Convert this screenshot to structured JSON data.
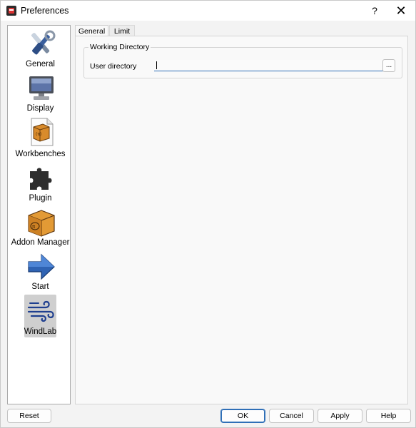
{
  "window": {
    "title": "Preferences",
    "help_label": "?",
    "close_label": "✕"
  },
  "sidebar": {
    "items": [
      {
        "label": "General",
        "icon": "tools-icon"
      },
      {
        "label": "Display",
        "icon": "monitor-icon"
      },
      {
        "label": "Workbenches",
        "icon": "package-document-icon"
      },
      {
        "label": "Plugin",
        "icon": "puzzle-piece-icon"
      },
      {
        "label": "Addon Manager",
        "icon": "box-icon"
      },
      {
        "label": "Start",
        "icon": "arrow-right-icon"
      },
      {
        "label": "WindLab",
        "icon": "wind-icon",
        "selected": true
      }
    ]
  },
  "tabs": [
    {
      "label": "General",
      "active": true
    },
    {
      "label": "Limit",
      "active": false
    }
  ],
  "general_tab": {
    "group_title": "Working Directory",
    "user_directory_label": "User directory",
    "user_directory_value": "",
    "browse_label": "..."
  },
  "buttons": {
    "reset": "Reset",
    "ok": "OK",
    "cancel": "Cancel",
    "apply": "Apply",
    "help": "Help"
  },
  "colors": {
    "accent": "#2f6fb7",
    "selection": "#cfcfcf"
  }
}
